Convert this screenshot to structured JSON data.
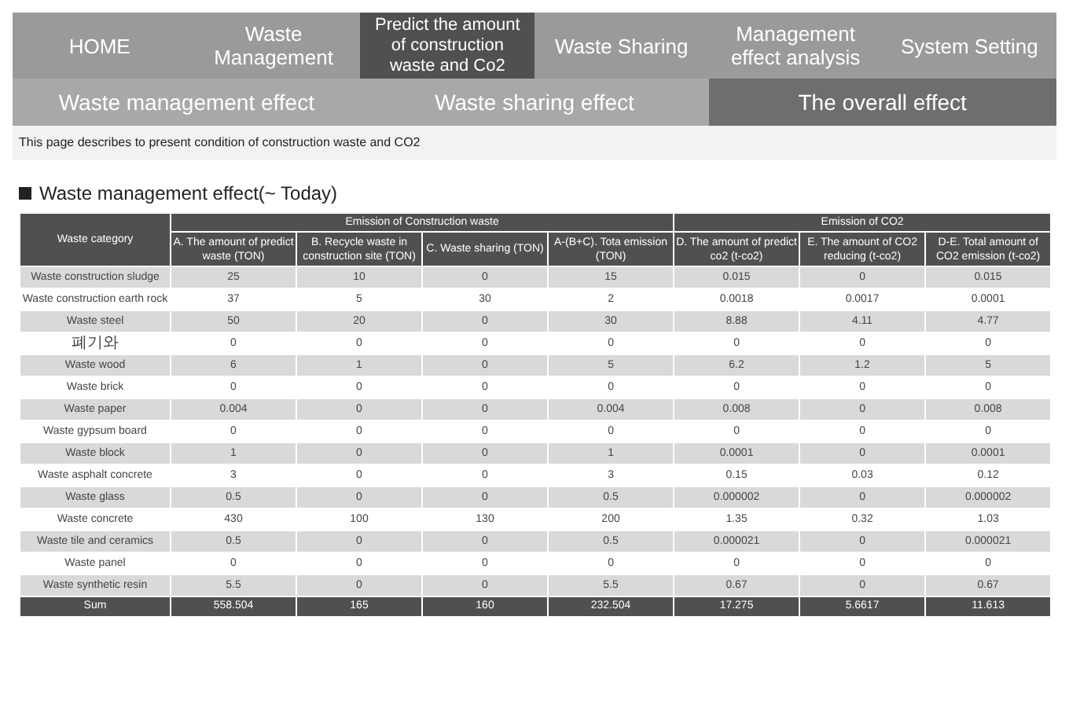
{
  "nav": [
    {
      "label": "HOME",
      "selected": false
    },
    {
      "label": "Waste Management",
      "selected": false
    },
    {
      "label": "Predict the amount of construction waste and Co2",
      "selected": true
    },
    {
      "label": "Waste Sharing",
      "selected": false
    },
    {
      "label": "Management effect analysis",
      "selected": false
    },
    {
      "label": "System Setting",
      "selected": false
    }
  ],
  "subtabs": [
    {
      "label": "Waste management effect",
      "selected": false
    },
    {
      "label": "Waste sharing effect",
      "selected": false
    },
    {
      "label": "The overall effect",
      "selected": true
    }
  ],
  "description": "This page describes to present condition of construction waste and CO2",
  "section_title": "Waste management effect(~ Today)",
  "table": {
    "groups": [
      "Emission of Construction waste",
      "Emission of CO2"
    ],
    "columns": [
      "Waste category",
      "A. The amount of predict waste (TON)",
      "B. Recycle waste in construction site (TON)",
      "C. Waste sharing (TON)",
      "A-(B+C). Tota emission (TON)",
      "D. The amount of predict co2 (t-co2)",
      "E. The amount of CO2 reducing (t-co2)",
      "D-E. Total amount of CO2 emission (t-co2)"
    ],
    "rows": [
      [
        "Waste construction sludge",
        "25",
        "10",
        "0",
        "15",
        "0.015",
        "0",
        "0.015"
      ],
      [
        "Waste construction earth rock",
        "37",
        "5",
        "30",
        "2",
        "0.0018",
        "0.0017",
        "0.0001"
      ],
      [
        "Waste steel",
        "50",
        "20",
        "0",
        "30",
        "8.88",
        "4.11",
        "4.77"
      ],
      [
        "폐기와",
        "0",
        "0",
        "0",
        "0",
        "0",
        "0",
        "0"
      ],
      [
        "Waste wood",
        "6",
        "1",
        "0",
        "5",
        "6.2",
        "1.2",
        "5"
      ],
      [
        "Waste brick",
        "0",
        "0",
        "0",
        "0",
        "0",
        "0",
        "0"
      ],
      [
        "Waste paper",
        "0.004",
        "0",
        "0",
        "0.004",
        "0.008",
        "0",
        "0.008"
      ],
      [
        "Waste gypsum board",
        "0",
        "0",
        "0",
        "0",
        "0",
        "0",
        "0"
      ],
      [
        "Waste block",
        "1",
        "0",
        "0",
        "1",
        "0.0001",
        "0",
        "0.0001"
      ],
      [
        "Waste asphalt concrete",
        "3",
        "0",
        "0",
        "3",
        "0.15",
        "0.03",
        "0.12"
      ],
      [
        "Waste glass",
        "0.5",
        "0",
        "0",
        "0.5",
        "0.000002",
        "0",
        "0.000002"
      ],
      [
        "Waste concrete",
        "430",
        "100",
        "130",
        "200",
        "1.35",
        "0.32",
        "1.03"
      ],
      [
        "Waste tile and ceramics",
        "0.5",
        "0",
        "0",
        "0.5",
        "0.000021",
        "0",
        "0.000021"
      ],
      [
        "Waste panel",
        "0",
        "0",
        "0",
        "0",
        "0",
        "0",
        "0"
      ],
      [
        "Waste synthetic resin",
        "5.5",
        "0",
        "0",
        "5.5",
        "0.67",
        "0",
        "0.67"
      ]
    ],
    "sum": [
      "Sum",
      "558.504",
      "165",
      "160",
      "232.504",
      "17.275",
      "5.6617",
      "11.613"
    ]
  }
}
